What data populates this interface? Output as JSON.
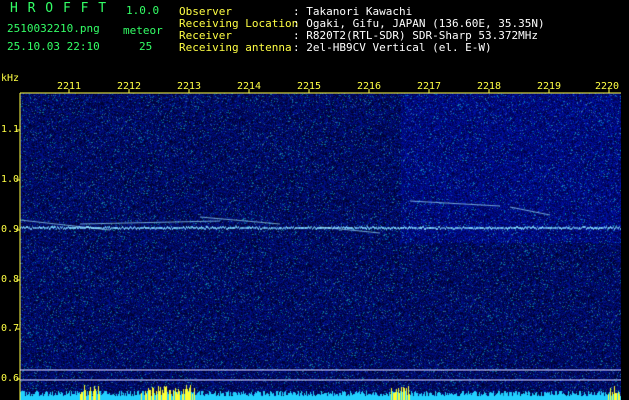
{
  "app": {
    "title": "H R O F F T",
    "version": "1.0.0"
  },
  "file": {
    "name": "2510032210.png",
    "datetime": "25.10.03 22:10"
  },
  "counter": {
    "label": "meteor",
    "value": "25"
  },
  "info": {
    "labels": [
      "Observer",
      "Receiving Location",
      "Receiver",
      "Receiving antenna"
    ],
    "values": [
      ": Takanori Kawachi",
      ": Ogaki, Gifu, JAPAN (136.60E, 35.35N)",
      ": R820T2(RTL-SDR) SDR-Sharp 53.372MHz",
      ": 2el-HB9CV Vertical (el. E-W)"
    ]
  },
  "axes": {
    "y_unit": "kHz",
    "y_ticks": [
      "1.1",
      "1.0",
      "0.9",
      "0.8",
      "0.7",
      "0.6"
    ],
    "x_ticks": [
      "2211",
      "2212",
      "2213",
      "2214",
      "2215",
      "2216",
      "2217",
      "2218",
      "2219",
      "2220"
    ]
  },
  "colors": {
    "background": "#000000",
    "header_text": "#33ff66",
    "header_values": "#ffffff",
    "axis_text": "#ffff44",
    "noise": "#0a1a9a",
    "signal": "#9fe8ff",
    "baseline_bars": "#22d0ff",
    "baseline_bursts": "#ffff33"
  }
}
